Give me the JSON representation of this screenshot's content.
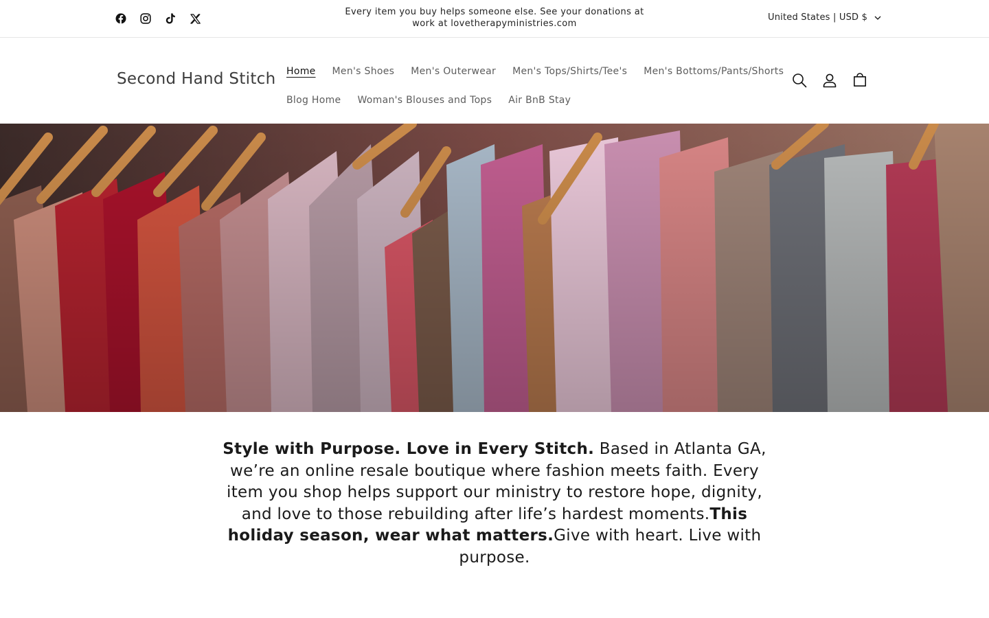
{
  "announcement": {
    "text": "Every item you buy helps someone else. See your donations at work at lovetherapyministries.com",
    "socials": [
      "facebook-icon",
      "instagram-icon",
      "tiktok-icon",
      "x-icon"
    ],
    "locale": "United States | USD $"
  },
  "header": {
    "logo": "Second Hand Stitch",
    "nav": [
      "Home",
      "Men's Shoes",
      "Men's Outerwear",
      "Men's Tops/Shirts/Tee's",
      "Men's Bottoms/Pants/Shorts",
      "Blog Home",
      "Woman's Blouses and Tops",
      "Air BnB Stay"
    ],
    "active_nav": "Home",
    "icons": [
      "search-icon",
      "account-icon",
      "cart-icon"
    ]
  },
  "intro": {
    "bold1": "Style with Purpose. Love in Every Stitch.",
    "text1": " Based in Atlanta GA, we’re an online resale boutique where fashion meets faith. Every item you shop helps support our ministry to restore hope, dignity, and love to those rebuilding after life’s hardest moments.",
    "bold2": "This holiday season, wear what matters.",
    "text2": "Give with heart. Live with purpose."
  },
  "colors": {
    "text": "#121212",
    "nav_muted": "#5c5c5c",
    "border": "#e6e6e6"
  }
}
